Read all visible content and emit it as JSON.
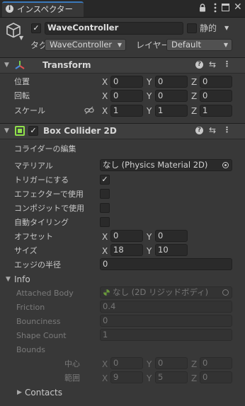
{
  "tab": {
    "title": "インスペクター",
    "info_icon": "info-icon",
    "lock_icon": "lock-icon",
    "window_icon": "window-icon",
    "menu_icon": "menu-icon"
  },
  "object": {
    "name": "WaveController",
    "active": true,
    "static_label": "静的",
    "static_checked": false,
    "tag_label": "タグ",
    "tag_value": "WaveController",
    "layer_label": "レイヤー",
    "layer_value": "Default"
  },
  "transform": {
    "title": "Transform",
    "rows": [
      {
        "label": "位置",
        "x": "0",
        "y": "0",
        "z": "0"
      },
      {
        "label": "回転",
        "x": "0",
        "y": "0",
        "z": "0"
      },
      {
        "label": "スケール",
        "x": "1",
        "y": "1",
        "z": "1"
      }
    ]
  },
  "collider": {
    "title": "Box Collider 2D",
    "enabled": true,
    "edit_label": "コライダーの編集",
    "material_label": "マテリアル",
    "material_value": "なし (Physics Material 2D)",
    "trigger_label": "トリガーにする",
    "trigger_checked": true,
    "effector_label": "エフェクターで使用",
    "effector_checked": false,
    "composite_label": "コンポジットで使用",
    "composite_checked": false,
    "autotiling_label": "自動タイリング",
    "autotiling_checked": false,
    "offset_label": "オフセット",
    "offset_x": "0",
    "offset_y": "0",
    "size_label": "サイズ",
    "size_x": "18",
    "size_y": "10",
    "edge_label": "エッジの半径",
    "edge_value": "0"
  },
  "info": {
    "title": "Info",
    "attached_label": "Attached Body",
    "attached_value": "なし (2D リジッドボディ)",
    "friction_label": "Friction",
    "friction_value": "0.4",
    "bounciness_label": "Bounciness",
    "bounciness_value": "0",
    "shape_count_label": "Shape Count",
    "shape_count_value": "1",
    "bounds_label": "Bounds",
    "center_label": "中心",
    "center": {
      "x": "0",
      "y": "0",
      "z": "0"
    },
    "extent_label": "範囲",
    "extent": {
      "x": "9",
      "y": "5",
      "z": "0"
    },
    "contacts_label": "Contacts"
  },
  "axes": {
    "x": "X",
    "y": "Y",
    "z": "Z"
  },
  "colors": {
    "background": "#383838",
    "field": "#2a2a2a",
    "header": "#3e3e3e",
    "tab": "#282828",
    "collider_icon": "#8fe04a"
  }
}
